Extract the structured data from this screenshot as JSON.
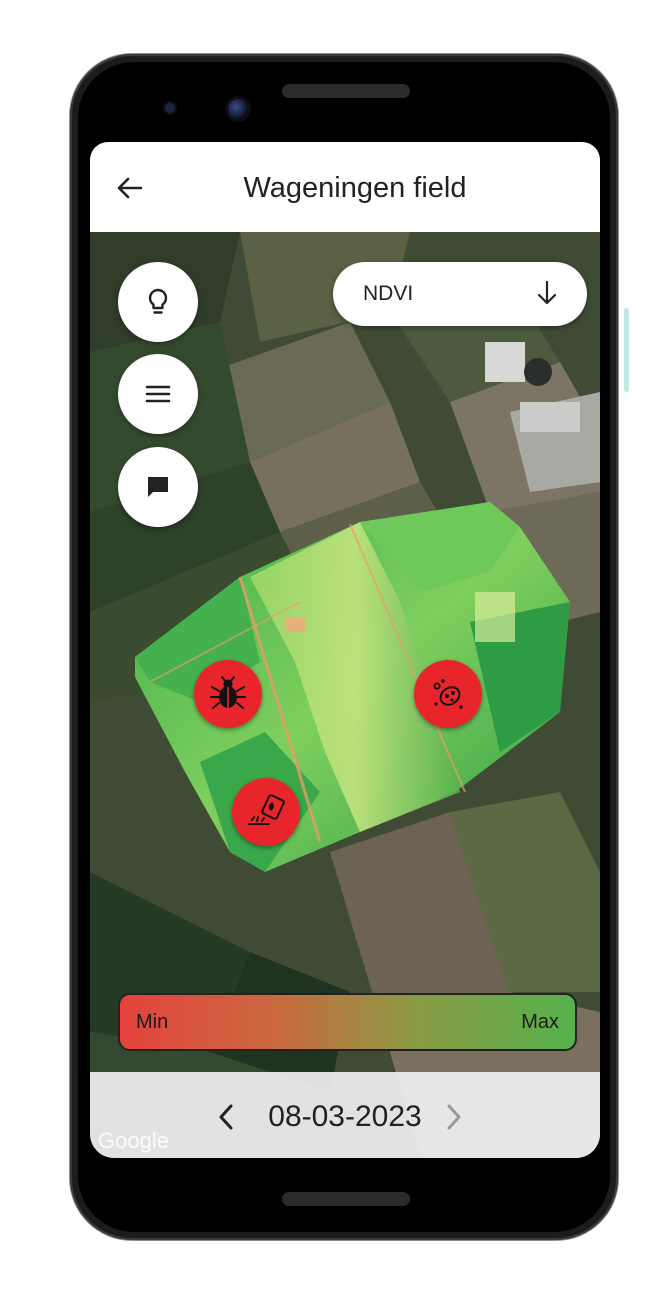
{
  "header": {
    "back_icon": "arrow-left-icon",
    "title": "Wageningen field"
  },
  "sidebar": {
    "buttons": [
      {
        "name": "lightbulb-button",
        "icon": "lightbulb-icon"
      },
      {
        "name": "menu-button",
        "icon": "menu-icon"
      },
      {
        "name": "chat-button",
        "icon": "chat-bubble-icon"
      }
    ]
  },
  "layer_select": {
    "value": "NDVI",
    "icon": "arrow-down-icon"
  },
  "markers": [
    {
      "name": "pest-marker",
      "icon": "bug-icon"
    },
    {
      "name": "disease-marker",
      "icon": "bacteria-icon"
    },
    {
      "name": "fertilizer-marker",
      "icon": "fertilizer-icon"
    }
  ],
  "legend": {
    "min_label": "Min",
    "max_label": "Max",
    "colors": [
      "#e5423d",
      "#c96a40",
      "#8a9a45",
      "#56b24c"
    ]
  },
  "date_nav": {
    "date": "08-03-2023",
    "prev_icon": "chevron-left-icon",
    "next_icon": "chevron-right-icon"
  },
  "map_attribution": "Google"
}
